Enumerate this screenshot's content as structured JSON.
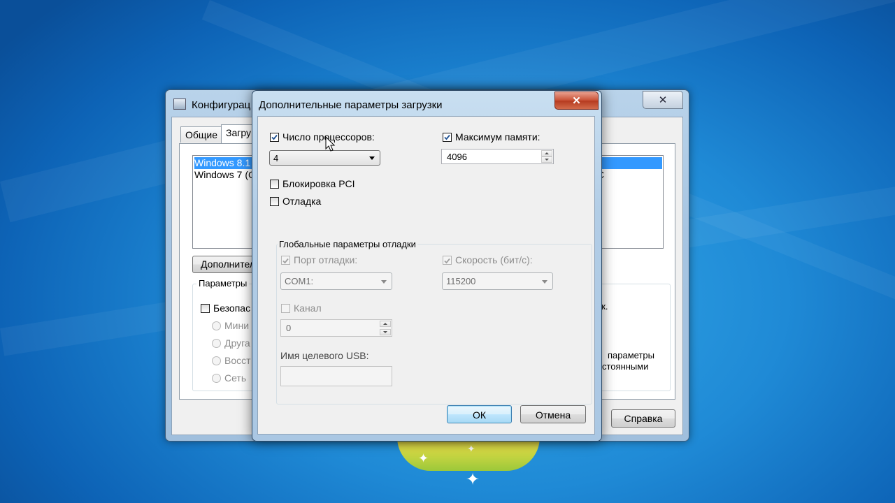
{
  "back_window": {
    "title": "Конфигурац",
    "tabs": [
      "Общие",
      "Загру"
    ],
    "os_list": [
      "Windows 8.1",
      "Windows 7 (C"
    ],
    "advanced_button": "Дополнител",
    "boot_options_label": "Параметры",
    "safe_boot_label": "Безопас",
    "radio_options": [
      "Мини",
      "Друга",
      "Восст",
      "Сеть"
    ],
    "right_fragments": {
      "sec": "ек.",
      "params": "параметры",
      "permanent": "стоянными",
      "list_c": "С"
    },
    "help_button": "Справка"
  },
  "dialog": {
    "title": "Дополнительные параметры загрузки",
    "close_icon": "close-icon",
    "num_processors": {
      "label": "Число процессоров:",
      "checked": true,
      "value": "4"
    },
    "max_memory": {
      "label": "Максимум памяти:",
      "checked": true,
      "value": "4096"
    },
    "pci_lock": {
      "label": "Блокировка PCI",
      "checked": false
    },
    "debug": {
      "label": "Отладка",
      "checked": false
    },
    "global_debug": {
      "legend": "Глобальные параметры отладки",
      "debug_port": {
        "label": "Порт отладки:",
        "checked": true,
        "value": "COM1:"
      },
      "baud_rate": {
        "label": "Скорость (бит/с):",
        "checked": true,
        "value": "115200"
      },
      "channel": {
        "label": "Канал",
        "checked": false,
        "value": "0"
      },
      "usb_target": {
        "label": "Имя целевого USB:",
        "value": ""
      }
    },
    "ok_label": "ОК",
    "cancel_label": "Отмена"
  },
  "colors": {
    "desktop": "#1f8ad6",
    "selection": "#3399ff",
    "close_red": "#c84e33"
  }
}
